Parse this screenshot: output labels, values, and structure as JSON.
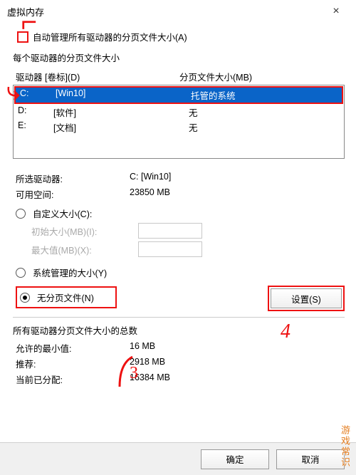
{
  "window": {
    "title": "虚拟内存",
    "close_label": "×"
  },
  "auto_manage_label": "自动管理所有驱动器的分页文件大小(A)",
  "per_drive_label": "每个驱动器的分页文件大小",
  "list_header": {
    "drive": "驱动器 [卷标](D)",
    "size": "分页文件大小(MB)"
  },
  "drives": [
    {
      "letter": "C:",
      "label": "[Win10]",
      "size": "托管的系统"
    },
    {
      "letter": "D:",
      "label": "[软件]",
      "size": "无"
    },
    {
      "letter": "E:",
      "label": "[文档]",
      "size": "无"
    }
  ],
  "selected_info": {
    "drive_label": "所选驱动器:",
    "drive_value": "C:  [Win10]",
    "space_label": "可用空间:",
    "space_value": "23850 MB"
  },
  "size_options": {
    "custom": "自定义大小(C):",
    "initial_label": "初始大小(MB)(I):",
    "max_label": "最大值(MB)(X):",
    "system": "系统管理的大小(Y)",
    "none": "无分页文件(N)"
  },
  "set_button": "设置(S)",
  "totals": {
    "title": "所有驱动器分页文件大小的总数",
    "min_label": "允许的最小值:",
    "min_value": "16 MB",
    "rec_label": "推荐:",
    "rec_value": "2918 MB",
    "cur_label": "当前已分配:",
    "cur_value": "16384 MB"
  },
  "buttons": {
    "ok": "确定",
    "cancel": "取消"
  },
  "watermark": "游戏常识",
  "annotations": {
    "step4": "4",
    "step3": "3"
  }
}
